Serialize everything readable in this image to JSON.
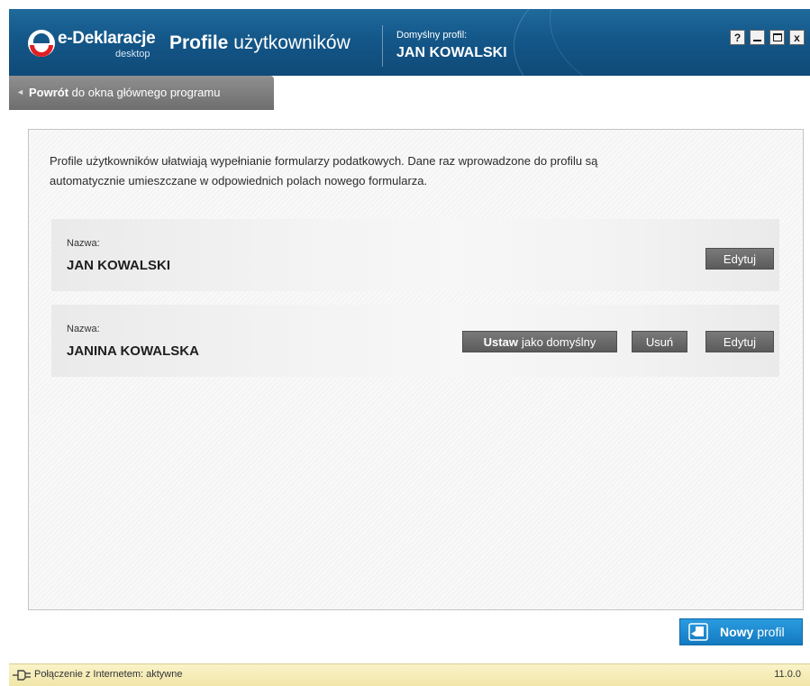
{
  "header": {
    "brand": "e-Deklaracje",
    "brand_sub": "desktop",
    "title_bold": "Profile",
    "title_rest": " użytkowników",
    "default_label": "Domyślny profil:",
    "default_name": "JAN KOWALSKI",
    "window_buttons": {
      "help": "?",
      "minimize": "_",
      "maximize": "□",
      "close": "x"
    }
  },
  "nav": {
    "back_bold": "Powrót",
    "back_rest": " do okna głównego programu"
  },
  "main": {
    "intro_line1": "Profile użytkowników ułatwiają wypełnianie formularzy podatkowych. Dane raz wprowadzone do profilu są",
    "intro_line2": "automatycznie umieszczane w odpowiednich polach nowego formularza.",
    "profiles": [
      {
        "label": "Nazwa:",
        "name": "JAN KOWALSKI",
        "edit": "Edytuj"
      },
      {
        "label": "Nazwa:",
        "name": "JANINA KOWALSKA",
        "set_default_bold": "Ustaw",
        "set_default_rest": " jako domyślny",
        "delete": "Usuń",
        "edit": "Edytuj"
      }
    ],
    "new_profile_bold": "Nowy",
    "new_profile_rest": " profil"
  },
  "status": {
    "connection": "Połączenie z Internetem: aktywne",
    "version": "11.0.0"
  },
  "colors": {
    "title_bar": "#145789",
    "accent_blue": "#1a8bd6",
    "button_gray": "#6a6a6a",
    "status_bg": "#f5edbd",
    "logo_red": "#e02020"
  },
  "icons": {
    "logo": "e-deklaracje-logo-icon",
    "back": "triangle-left-icon",
    "new_profile": "hand-document-icon",
    "connection": "plug-icon"
  }
}
